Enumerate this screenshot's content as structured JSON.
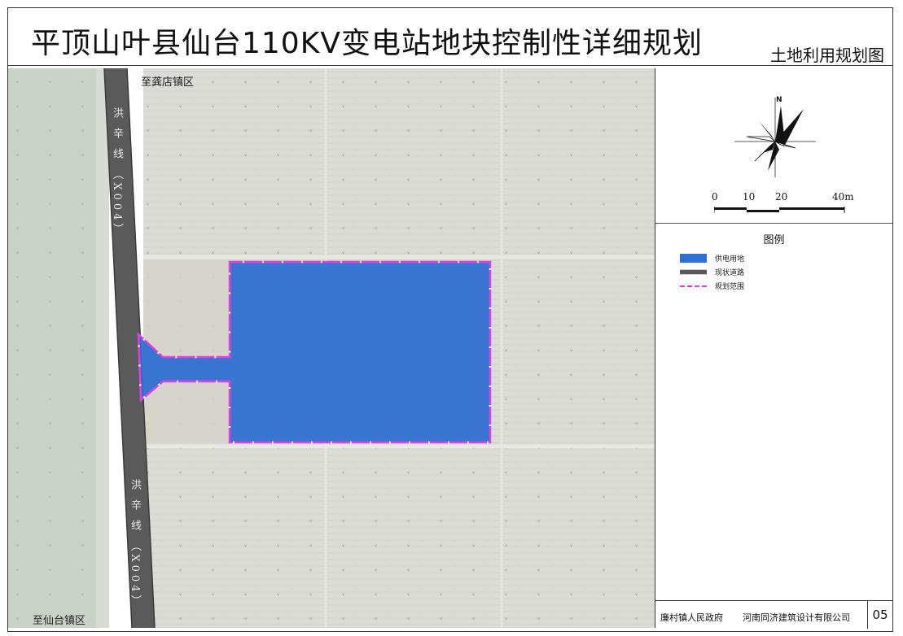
{
  "header": {
    "title": "平顶山叶县仙台110KV变电站地块控制性详细规划",
    "map_kind": "土地利用规划图"
  },
  "map": {
    "label_north_road": "至龚店镇区",
    "label_south_road": "至仙台镇区",
    "road_name_1": "洪 辛 线 （X004）",
    "road_name_2": "洪 辛 线 （X004）",
    "colors": {
      "power_land": "#2f6fd1",
      "boundary": "#e040e0",
      "road": "#5a5a5a",
      "field": "#dcdcd6",
      "field_dark": "#c6ccc4"
    }
  },
  "compass": {
    "north_label": "N"
  },
  "scale": {
    "ticks": [
      "0",
      "10",
      "20",
      "40m"
    ]
  },
  "legend": {
    "title": "图例",
    "items": [
      {
        "label": "供电用地",
        "icon": "blue-fill"
      },
      {
        "label": "现状道路",
        "icon": "gray-road-line"
      },
      {
        "label": "规划范围",
        "icon": "magenta-dashed-line"
      }
    ]
  },
  "footer": {
    "client": "廉村镇人民政府",
    "designer": "河南同济建筑设计有限公司",
    "sheet_number": "05"
  }
}
